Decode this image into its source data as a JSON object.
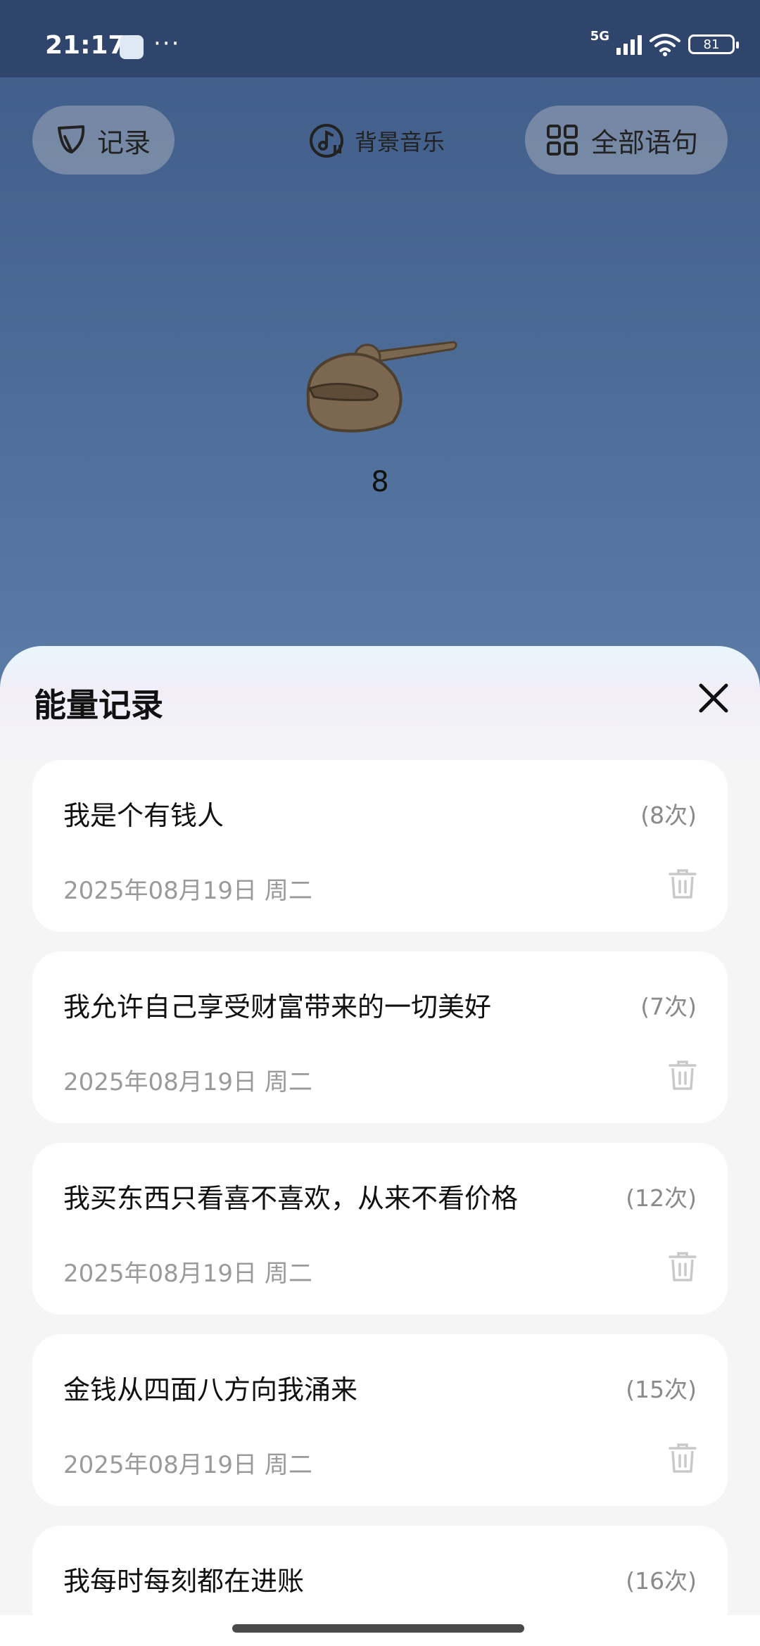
{
  "status_bar": {
    "time": "21:17",
    "overflow": "···",
    "network": "5G",
    "battery": "81"
  },
  "top_actions": {
    "record_label": "记录",
    "music_label": "背景音乐",
    "all_phrases_label": "全部语句"
  },
  "counter": "8",
  "sheet": {
    "title": "能量记录",
    "records": [
      {
        "phrase": "我是个有钱人",
        "times": "(8次)",
        "date": "2025年08月19日 周二"
      },
      {
        "phrase": "我允许自己享受财富带来的一切美好",
        "times": "(7次)",
        "date": "2025年08月19日 周二"
      },
      {
        "phrase": "我买东西只看喜不喜欢，从来不看价格",
        "times": "(12次)",
        "date": "2025年08月19日 周二"
      },
      {
        "phrase": "金钱从四面八方向我涌来",
        "times": "(15次)",
        "date": "2025年08月19日 周二"
      },
      {
        "phrase": "我每时每刻都在进账",
        "times": "(16次)",
        "date": ""
      }
    ]
  },
  "icons": [
    "leaf-icon",
    "music-note-icon",
    "grid-icon",
    "close-icon",
    "trash-icon",
    "wooden-fish-icon"
  ]
}
